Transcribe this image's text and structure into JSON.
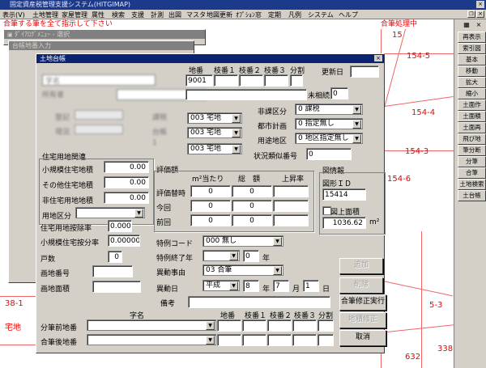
{
  "app": {
    "title": "固定資産税管理支援システム(HITGIMAP)",
    "menu": [
      "表示(V)",
      "土地管理",
      "家屋管理",
      "属性",
      "検索",
      "支援",
      "計測",
      "出図",
      "マスタ",
      "地図更新",
      "ｵﾌﾟｼｮﾝ",
      "窓",
      "定期",
      "凡例",
      "システム",
      "ヘルプ"
    ],
    "notice": "合筆する筆を全て指示して下さい",
    "status_right": "合筆処理中"
  },
  "toolbar_right": [
    "再表示",
    "索引図",
    "基本",
    "移動",
    "拡大",
    "縮小",
    "土面作",
    "土面積",
    "土面再",
    "飛び地",
    "筆分断",
    "分筆",
    "合筆",
    "土地検索",
    "土台帳"
  ],
  "map_labels": [
    "154-5",
    "154-4",
    "15",
    "154-3",
    "154-6",
    "38-1",
    "宅地",
    "5-3",
    "632",
    "338"
  ],
  "bg_dialog1": {
    "title": "ﾀﾞｲｱﾛｸﾞﾒﾆｭｰ - 選択",
    "icon": "dialog-icon"
  },
  "bg_dialog2": {
    "title": "台帳地番入力"
  },
  "dialog": {
    "title": "土地台帳",
    "headers": {
      "chiban": "地番",
      "eda1": "枝番１",
      "eda2": "枝番２",
      "eda3": "枝番３",
      "bunkatsu": "分割"
    },
    "chiban_value": "9001",
    "koshin_label": "更新日",
    "misoku_label": "未相続",
    "misoku_value": "0",
    "hikazei": {
      "label": "非課区分",
      "value": "0 課税"
    },
    "toshi": {
      "label": "都市計画",
      "value": "0 指定無し"
    },
    "yoto": {
      "label": "用途地区",
      "value": "0 地区指定無し"
    },
    "jokyo": {
      "label": "状況類似番号",
      "value": "0"
    },
    "chimoku_rows": [
      "003 宅地",
      "003 宅地",
      "003 宅地"
    ],
    "blurred": [
      "字名",
      "登記",
      "現況",
      "課税",
      "台帳",
      "所有者",
      "1"
    ],
    "jutaku": {
      "title": "住宅用地関連",
      "rows": [
        {
          "label": "小規模住宅地積",
          "value": "0.00"
        },
        {
          "label": "その他住宅地積",
          "value": "0.00"
        },
        {
          "label": "非住宅用地地積",
          "value": "0.00"
        }
      ],
      "yochi_label": "用地区分",
      "jojo_label": "住宅用地按除率",
      "jojo_value": "0.000",
      "shokibo_label": "小規模住宅按分率",
      "shokibo_value": "0.00000",
      "kosu_label": "戸数",
      "kosu_value": "0",
      "kakuchi_label": "画地番号",
      "kakuchi_menseki_label": "画地面積"
    },
    "hyoka": {
      "title": "評価額",
      "cols": [
        "m²当たり",
        "総　額",
        "上昇率"
      ],
      "rows": [
        {
          "label": "評価替時",
          "v1": "0",
          "v2": "0"
        },
        {
          "label": "今回",
          "v1": "0",
          "v2": "0"
        },
        {
          "label": "前回",
          "v1": "0",
          "v2": "0"
        }
      ]
    },
    "zukei": {
      "title": "図情報",
      "id_label": "図形ＩＤ",
      "id_value": "15414",
      "menseki_label": "図上面積",
      "menseki_value": "1036.62",
      "unit": "m²"
    },
    "tokurei": {
      "label": "特例コード",
      "value": "000 無し"
    },
    "tokurei_end": {
      "label": "特例終了年",
      "value": "0",
      "unit": "年"
    },
    "ido_jiyu": {
      "label": "異動事由",
      "value": "03 合筆"
    },
    "ido_bi": {
      "label": "異動日",
      "era": "平成",
      "year": "8",
      "month": "7",
      "day": "1",
      "y": "年",
      "m": "月",
      "d": "日"
    },
    "biko_label": "備考",
    "buttons": {
      "add": "追加",
      "delete": "削除",
      "execute": "合筆修正実行",
      "predict": "地積修正",
      "cancel": "取消"
    },
    "bottom": {
      "aza": "字名",
      "chiban": "地番",
      "eda1": "枝番１",
      "eda2": "枝番２",
      "eda3": "枝番３",
      "bunkatsu": "分割",
      "mae": "分筆前地番",
      "ato": "合筆後地番"
    }
  },
  "colors": {
    "title_active": "#0a2472",
    "face": "#d4d0c8",
    "notice": "#e00000"
  }
}
